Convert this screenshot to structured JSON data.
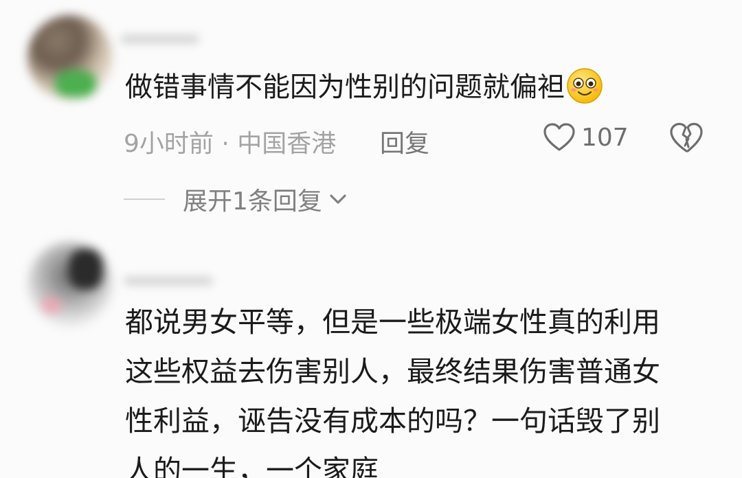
{
  "comments": [
    {
      "text": "做错事情不能因为性别的问题就偏袒",
      "emoji": "smiling-face-emoji",
      "meta": "9小时前 · 中国香港",
      "reply_label": "回复",
      "likes": "107",
      "expand_label": "展开1条回复"
    },
    {
      "lines": [
        "都说男女平等，但是一些极端女性真的利用",
        "这些权益去伤害别人，最终结果伤害普通女",
        "性利益，诬告没有成本的吗？一句话毁了别",
        "人的一生，一个家庭"
      ]
    }
  ],
  "colors": {
    "text": "#1b1b1b",
    "meta": "#a3a3a3",
    "icon": "#6e6e6e",
    "background": "#fbfbfb"
  }
}
